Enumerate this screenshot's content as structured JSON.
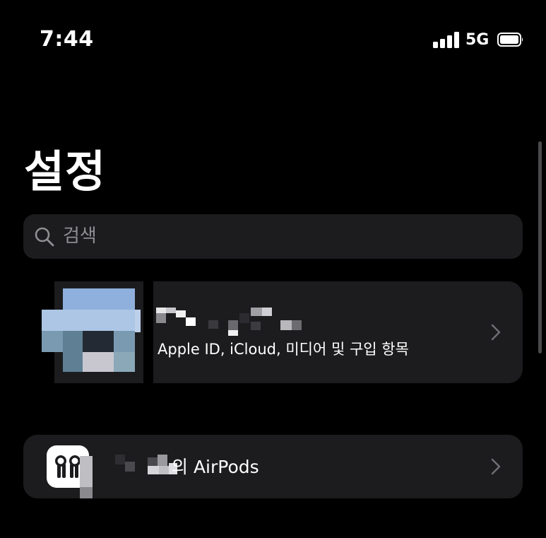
{
  "status_bar": {
    "time": "7:44",
    "network": "5G",
    "signal_icon": "cellular-signal-icon",
    "battery_icon": "battery-icon",
    "signal_bars": 4
  },
  "header": {
    "title": "설정"
  },
  "search": {
    "placeholder": "검색",
    "icon": "search-icon"
  },
  "profile": {
    "name": "",
    "subtitle": "Apple ID, iCloud, 미디어 및 구입 항목",
    "chevron": "chevron-right-icon"
  },
  "airpods": {
    "label": "의 AirPods",
    "icon": "airpods-icon",
    "chevron": "chevron-right-icon"
  },
  "colors": {
    "background": "#000000",
    "card": "#1c1c1e",
    "secondary_text": "#8e8e93"
  }
}
